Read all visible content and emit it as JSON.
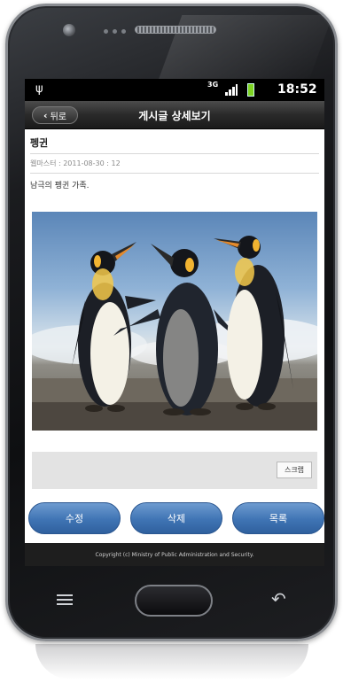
{
  "status_bar": {
    "usb_icon": "usb-icon",
    "network": "3G",
    "time": "18:52"
  },
  "header": {
    "back_label": "뒤로",
    "title": "게시글 상세보기"
  },
  "post": {
    "title": "펭귄",
    "meta": "웹마스터 : 2011-08-30 : 12",
    "body": "남극의 펭귄 가족.",
    "image_desc": "penguins-photo"
  },
  "scrap_button": "스크랩",
  "actions": {
    "edit": "수정",
    "delete": "삭제",
    "list": "목록"
  },
  "footer": "Copyright (c) Ministry of Public Administration and Security.",
  "colors": {
    "action_button": "#3f74b4",
    "title_bar": "#2a2a2a",
    "battery": "#7ed321"
  }
}
